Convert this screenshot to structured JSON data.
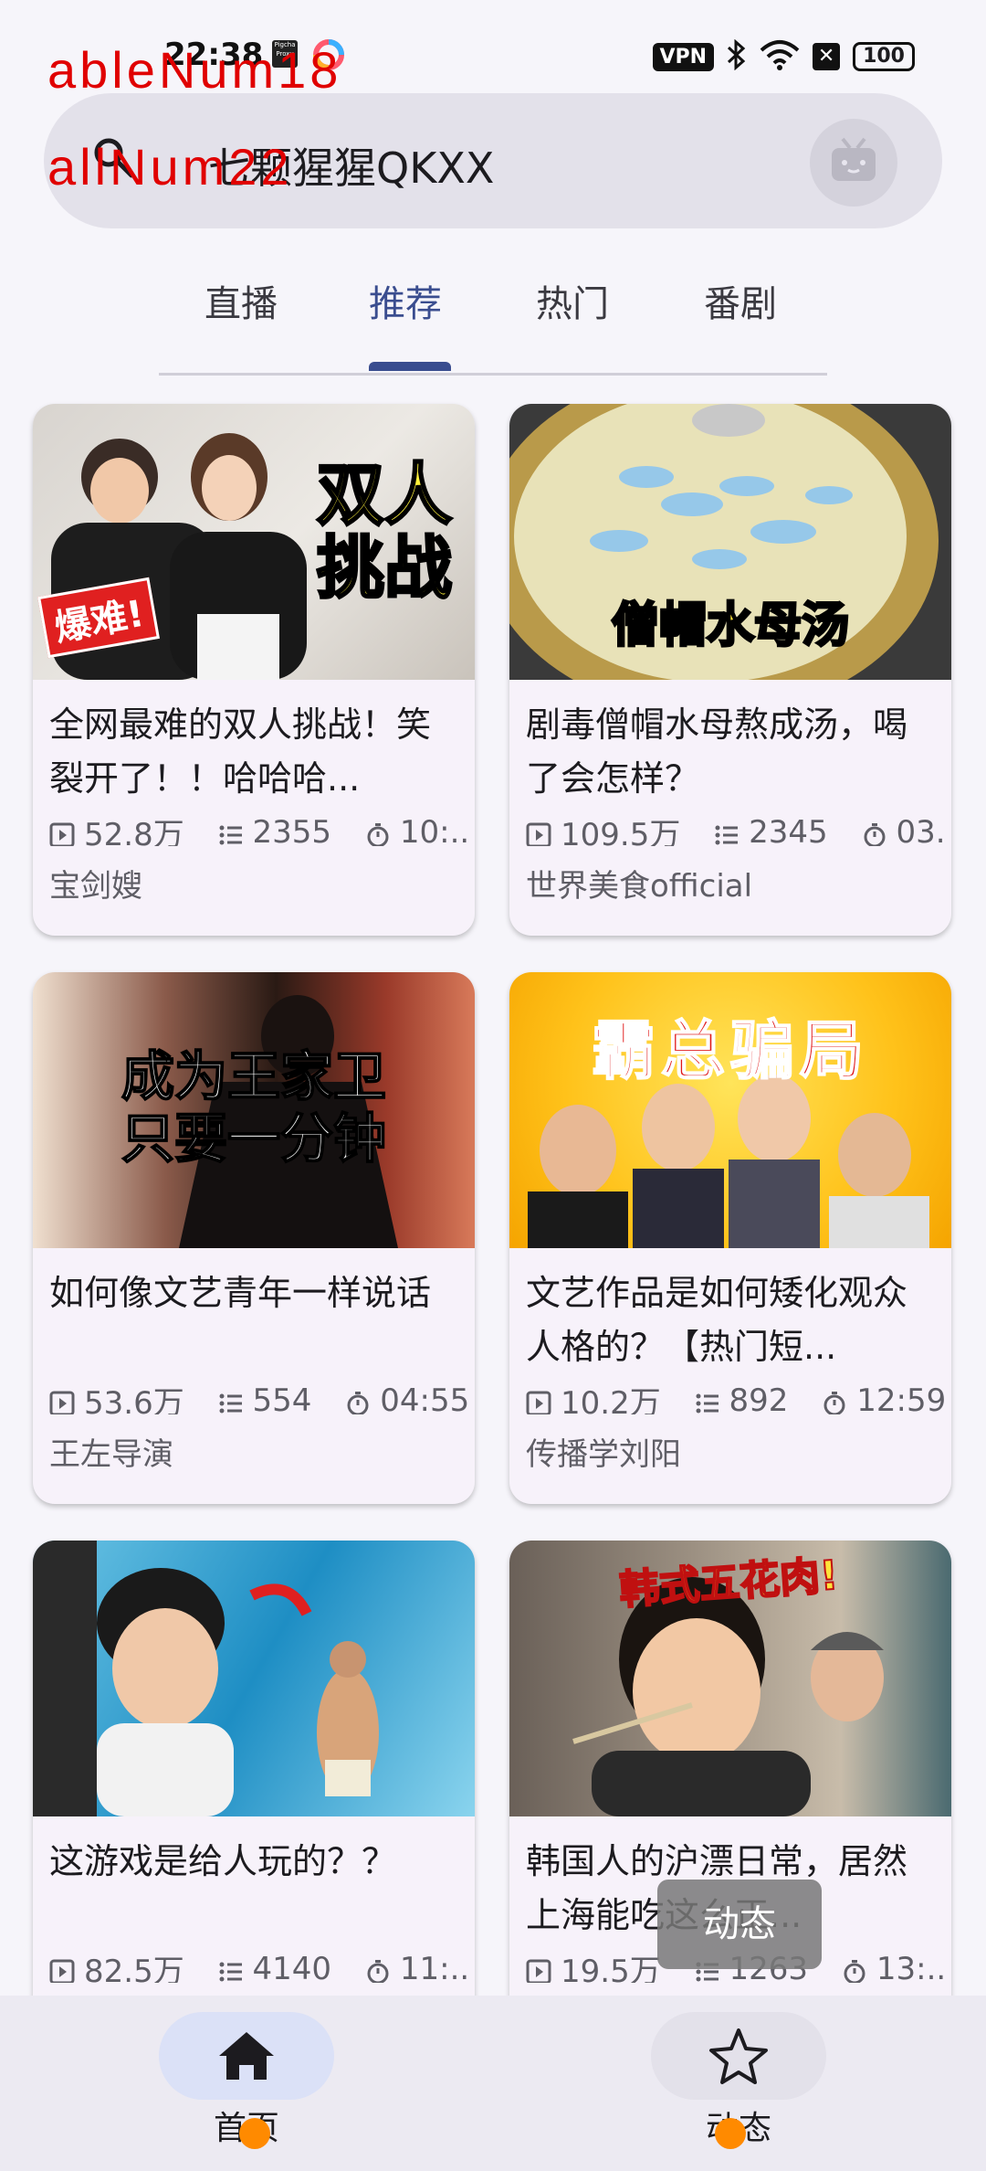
{
  "status": {
    "time": "22:38",
    "vpn": "VPN",
    "battery": "100",
    "badge": "Pigcha Proxy"
  },
  "debug": {
    "line1": "ableNum18",
    "line2": "allNum22"
  },
  "search": {
    "text": "七颗猩猩QKXX"
  },
  "tabs": [
    "直播",
    "推荐",
    "热门",
    "番剧"
  ],
  "active_tab": "推荐",
  "videos": [
    {
      "title": "全网最难的双人挑战！笑裂开了！！哈哈哈...",
      "views": "52.8万",
      "danmaku": "2355",
      "duration": "10:...",
      "author": "宝剑嫂",
      "overlay": "双人\n挑战",
      "badge": "爆难!"
    },
    {
      "title": "剧毒僧帽水母熬成汤，喝了会怎样？",
      "views": "109.5万",
      "danmaku": "2345",
      "duration": "03...",
      "author": "世界美食official",
      "overlay": "僧帽水母汤"
    },
    {
      "title": "如何像文艺青年一样说话",
      "views": "53.6万",
      "danmaku": "554",
      "duration": "04:55",
      "author": "王左导演",
      "overlay": "成为王家卫\n只要一分钟"
    },
    {
      "title": "文艺作品是如何矮化观众人格的？【热门短...",
      "views": "10.2万",
      "danmaku": "892",
      "duration": "12:59",
      "author": "传播学刘阳",
      "overlay": "霸总骗局"
    },
    {
      "title": "这游戏是给人玩的？？",
      "views": "82.5万",
      "danmaku": "4140",
      "duration": "11:...",
      "author": "",
      "overlay": ""
    },
    {
      "title": "韩国人的沪漂日常，居然上海能吃这么正...",
      "views": "19.5万",
      "danmaku": "1263",
      "duration": "13:...",
      "author": "",
      "overlay": "韩式五花肉!"
    }
  ],
  "toast": "动态",
  "nav": {
    "home": "首页",
    "dynamic": "动态"
  },
  "colors": {
    "accent": "#3a4d8f",
    "background": "#f6f5fa",
    "card": "#f7f2fa"
  }
}
